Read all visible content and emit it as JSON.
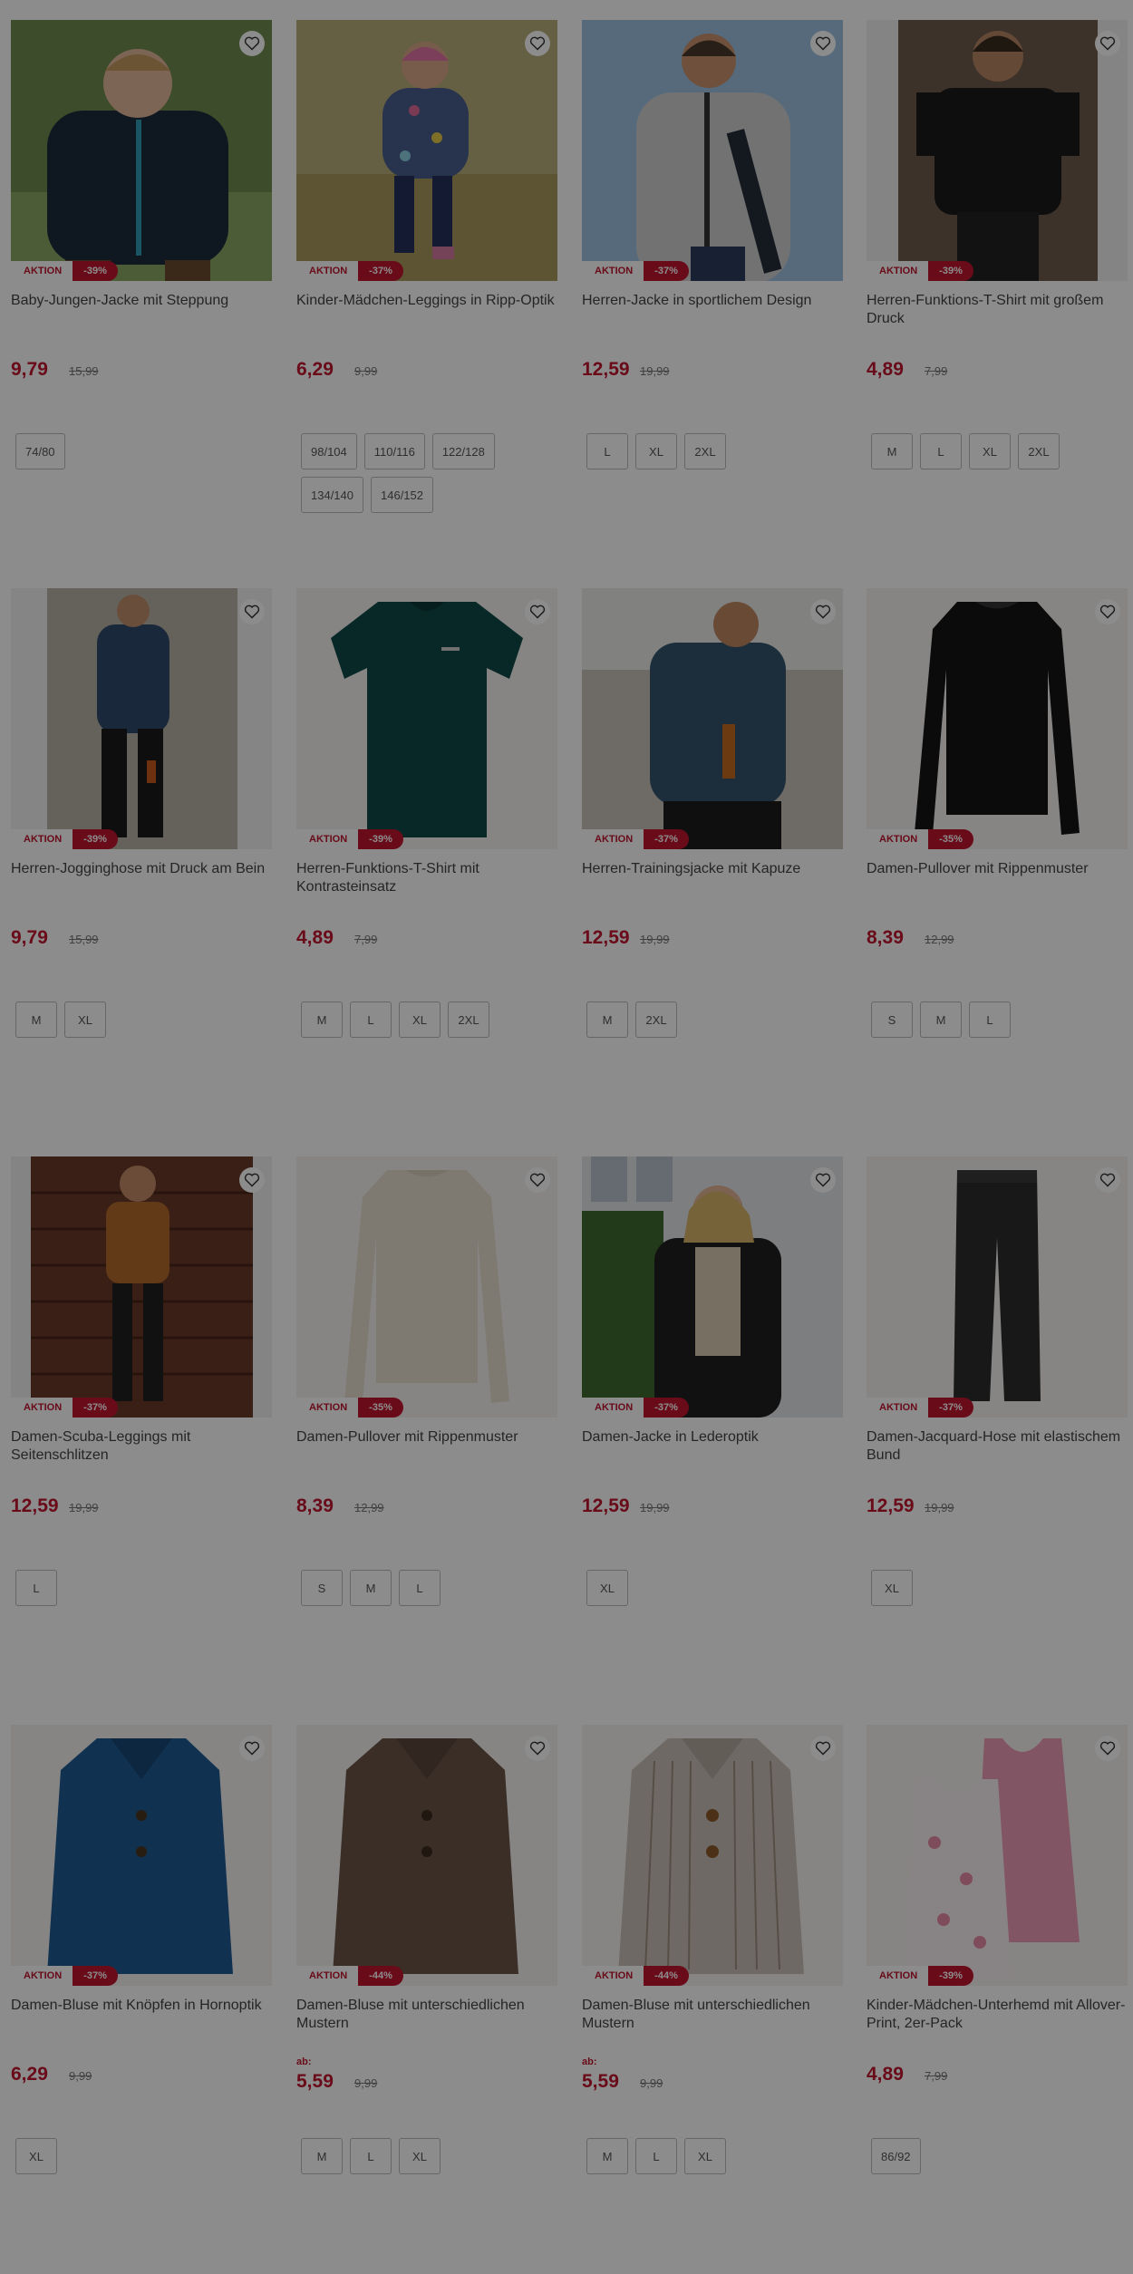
{
  "labels": {
    "aktion": "AKTION",
    "from": "ab:"
  },
  "rows": [
    [
      {
        "title": "Baby-Jungen-Jacke mit Steppung",
        "discount": "-39%",
        "price": "9,79",
        "old": "15,99",
        "sizes": [
          "74/80"
        ]
      },
      {
        "title": "Kinder-Mädchen-Leggings in Ripp-Optik",
        "discount": "-37%",
        "price": "6,29",
        "old": "9,99",
        "sizes": [
          "98/104",
          "110/116",
          "122/128",
          "134/140",
          "146/152"
        ]
      },
      {
        "title": "Herren-Jacke in sportlichem Design",
        "discount": "-37%",
        "price": "12,59",
        "old": "19,99",
        "sizes": [
          "L",
          "XL",
          "2XL"
        ]
      },
      {
        "title": "Herren-Funktions-T-Shirt mit großem Druck",
        "discount": "-39%",
        "price": "4,89",
        "old": "7,99",
        "sizes": [
          "M",
          "L",
          "XL",
          "2XL"
        ]
      }
    ],
    [
      {
        "title": "Herren-Jogginghose mit Druck am Bein",
        "discount": "-39%",
        "price": "9,79",
        "old": "15,99",
        "sizes": [
          "M",
          "XL"
        ]
      },
      {
        "title": "Herren-Funktions-T-Shirt mit Kontrasteinsatz",
        "discount": "-39%",
        "price": "4,89",
        "old": "7,99",
        "sizes": [
          "M",
          "L",
          "XL",
          "2XL"
        ]
      },
      {
        "title": "Herren-Trainingsjacke mit Kapuze",
        "discount": "-37%",
        "price": "12,59",
        "old": "19,99",
        "sizes": [
          "M",
          "2XL"
        ]
      },
      {
        "title": "Damen-Pullover mit Rippenmuster",
        "discount": "-35%",
        "price": "8,39",
        "old": "12,99",
        "sizes": [
          "S",
          "M",
          "L"
        ]
      }
    ],
    [
      {
        "title": "Damen-Scuba-Leggings mit Seitenschlitzen",
        "discount": "-37%",
        "price": "12,59",
        "old": "19,99",
        "sizes": [
          "L"
        ]
      },
      {
        "title": "Damen-Pullover mit Rippenmuster",
        "discount": "-35%",
        "price": "8,39",
        "old": "12,99",
        "sizes": [
          "S",
          "M",
          "L"
        ]
      },
      {
        "title": "Damen-Jacke in Lederoptik",
        "discount": "-37%",
        "price": "12,59",
        "old": "19,99",
        "sizes": [
          "XL"
        ]
      },
      {
        "title": "Damen-Jacquard-Hose mit elastischem Bund",
        "discount": "-37%",
        "price": "12,59",
        "old": "19,99",
        "sizes": [
          "XL"
        ]
      }
    ],
    [
      {
        "title": "Damen-Bluse mit Knöpfen in Hornoptik",
        "discount": "-37%",
        "price": "6,29",
        "old": "9,99",
        "sizes": [
          "XL"
        ]
      },
      {
        "title": "Damen-Bluse mit unterschiedlichen Mustern",
        "discount": "-44%",
        "price": "5,59",
        "old": "9,99",
        "from": true,
        "sizes": [
          "M",
          "L",
          "XL"
        ]
      },
      {
        "title": "Damen-Bluse mit unterschiedlichen Mustern",
        "discount": "-44%",
        "price": "5,59",
        "old": "9,99",
        "from": true,
        "sizes": [
          "M",
          "L",
          "XL"
        ]
      },
      {
        "title": "Kinder-Mädchen-Unterhemd mit Allover-Print, 2er-Pack",
        "discount": "-39%",
        "price": "4,89",
        "old": "7,99",
        "sizes": [
          "86/92"
        ]
      }
    ]
  ],
  "images": [
    [
      "puffer-jacket-boy-image",
      "floral-jacket-girl-image",
      "grey-fleece-jacket-man-image",
      "black-tshirt-man-image"
    ],
    [
      "jogging-pants-man-image",
      "green-tshirt-image",
      "training-jacket-man-image",
      "black-pullover-image"
    ],
    [
      "scuba-leggings-woman-image",
      "cream-pullover-image",
      "leather-jacket-woman-image",
      "jacquard-trousers-image"
    ],
    [
      "blue-blouse-image",
      "brown-pattern-blouse-image",
      "striped-blouse-image",
      "girls-undershirts-image"
    ]
  ],
  "colors": {
    "accent": "#c0152f",
    "overlay": "rgba(0,0,0,0.45)"
  }
}
